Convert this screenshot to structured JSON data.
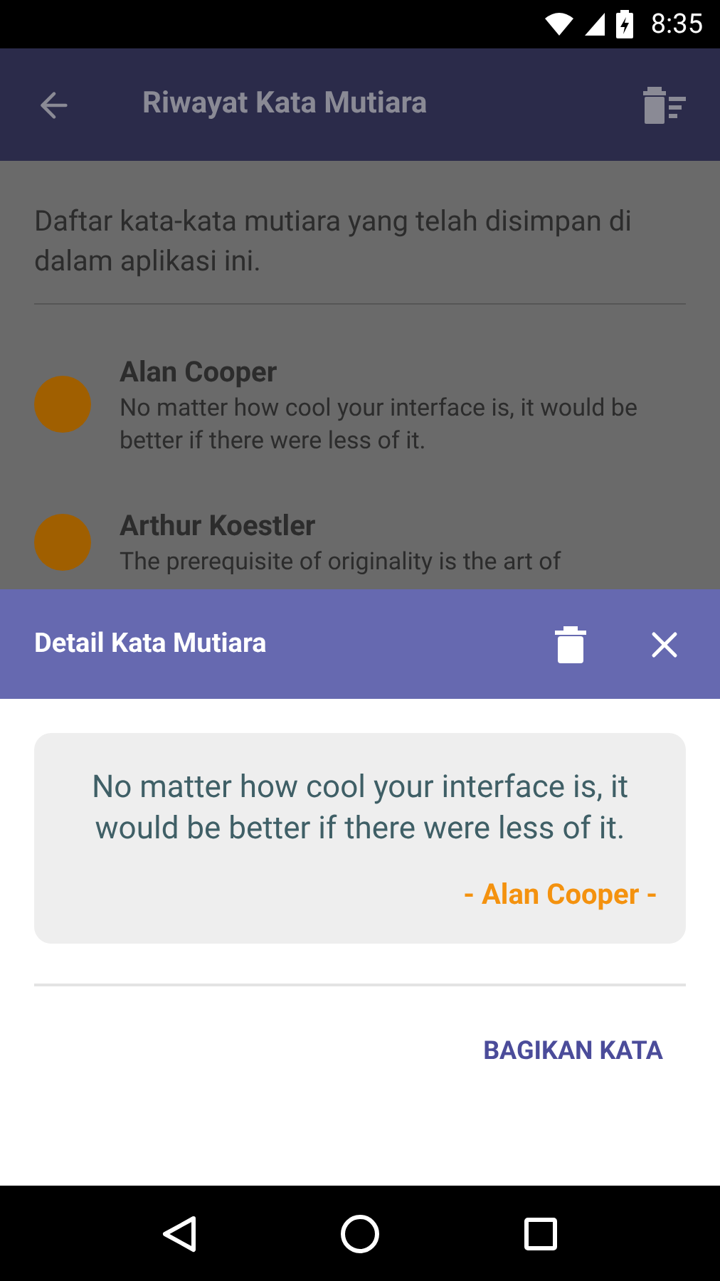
{
  "status_bar": {
    "time": "8:35"
  },
  "app_bar": {
    "title": "Riwayat Kata Mutiara"
  },
  "intro": "Daftar kata-kata mutiara yang telah disimpan di dalam aplikasi ini.",
  "quotes": [
    {
      "author": "Alan Cooper",
      "text": "No matter how cool your interface is, it would be better if there were less of it."
    },
    {
      "author": "Arthur Koestler",
      "text": "The prerequisite of originality is the art of"
    }
  ],
  "sheet": {
    "title": "Detail Kata Mutiara",
    "quote": "No matter how cool your interface is, it would be better if there were less of it.",
    "author": "- Alan Cooper -",
    "action": "BAGIKAN KATA"
  }
}
